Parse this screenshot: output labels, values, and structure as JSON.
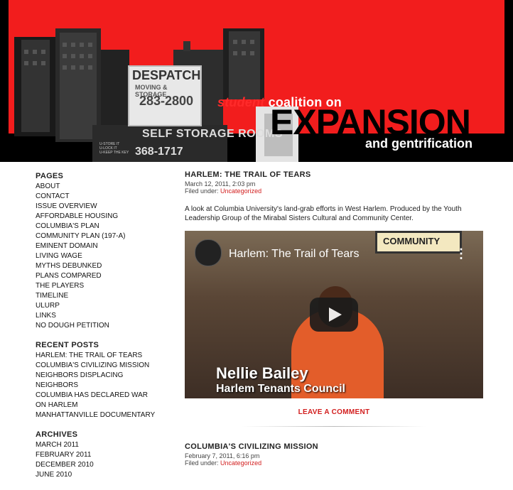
{
  "header": {
    "student": "student",
    "coalition": "coalition on",
    "expansion": "EXPANSION",
    "gentrification": "and gentrification",
    "despatch": "DESPATCH",
    "moving": "MOVING & STORAGE",
    "phone": "283-2800",
    "self_storage": "SELF STORAGE ROOMS",
    "phone2": "368-1717",
    "storage_lines": [
      "U-STORE IT",
      "U-LOCK IT",
      "U-KEEP THE KEY"
    ]
  },
  "sidebar": {
    "pages_title": "PAGES",
    "pages": [
      "ABOUT",
      "CONTACT",
      "ISSUE OVERVIEW",
      "AFFORDABLE HOUSING",
      "COLUMBIA'S PLAN",
      "COMMUNITY PLAN (197-A)",
      "EMINENT DOMAIN",
      "LIVING WAGE",
      "MYTHS DEBUNKED",
      "PLANS COMPARED",
      "THE PLAYERS",
      "TIMELINE",
      "ULURP",
      "LINKS",
      "NO DOUGH PETITION"
    ],
    "recent_title": "RECENT POSTS",
    "recent": [
      "HARLEM: THE TRAIL OF TEARS",
      "COLUMBIA'S CIVILIZING MISSION",
      "NEIGHBORS DISPLACING NEIGHBORS",
      "COLUMBIA HAS DECLARED WAR ON HARLEM",
      "MANHATTANVILLE DOCUMENTARY"
    ],
    "archives_title": "ARCHIVES",
    "archives": [
      "MARCH 2011",
      "FEBRUARY 2011",
      "DECEMBER 2010",
      "JUNE 2010"
    ]
  },
  "post1": {
    "title": "HARLEM: THE TRAIL OF TEARS",
    "date": "March 12, 2011, 2:03 pm",
    "filed_label": "Filed under:",
    "category": "Uncategorized",
    "excerpt": "A look at Columbia University's land-grab efforts in West Harlem. Produced by the Youth Leadership Group of the Mirabal Sisters Cultural and Community Center.",
    "video_title": "Harlem: The Trail of Tears",
    "video_sign": "COMMUNITY",
    "caption_name": "Nellie Bailey",
    "caption_org": "Harlem Tenants Council",
    "comment_link": "LEAVE A COMMENT"
  },
  "post2": {
    "title": "COLUMBIA'S CIVILIZING MISSION",
    "date": "February 7, 2011, 6:16 pm",
    "filed_label": "Filed under:",
    "category": "Uncategorized"
  },
  "colors": {
    "banner_red": "#f21d1d",
    "link_red": "#d21e1e"
  }
}
